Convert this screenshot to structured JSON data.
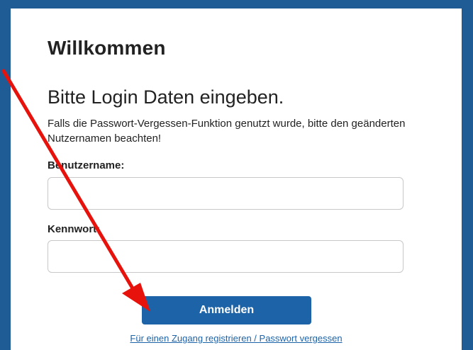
{
  "page": {
    "heading": "Willkommen",
    "subheading": "Bitte Login Daten eingeben.",
    "hint": "Falls die Passwort-Vergessen-Funktion genutzt wurde, bitte den geänderten Nutzernamen beachten!"
  },
  "form": {
    "username_label": "Benutzername:",
    "username_value": "",
    "password_label": "Kennwort:",
    "password_value": "",
    "submit_label": "Anmelden",
    "register_link": "Für einen Zugang registrieren / Passwort vergessen"
  },
  "annotation": {
    "arrow_color": "#e8120c",
    "icon": "arrow-icon"
  },
  "colors": {
    "frame": "#1f5c96",
    "button": "#1d63a8",
    "link": "#1d63a8"
  }
}
